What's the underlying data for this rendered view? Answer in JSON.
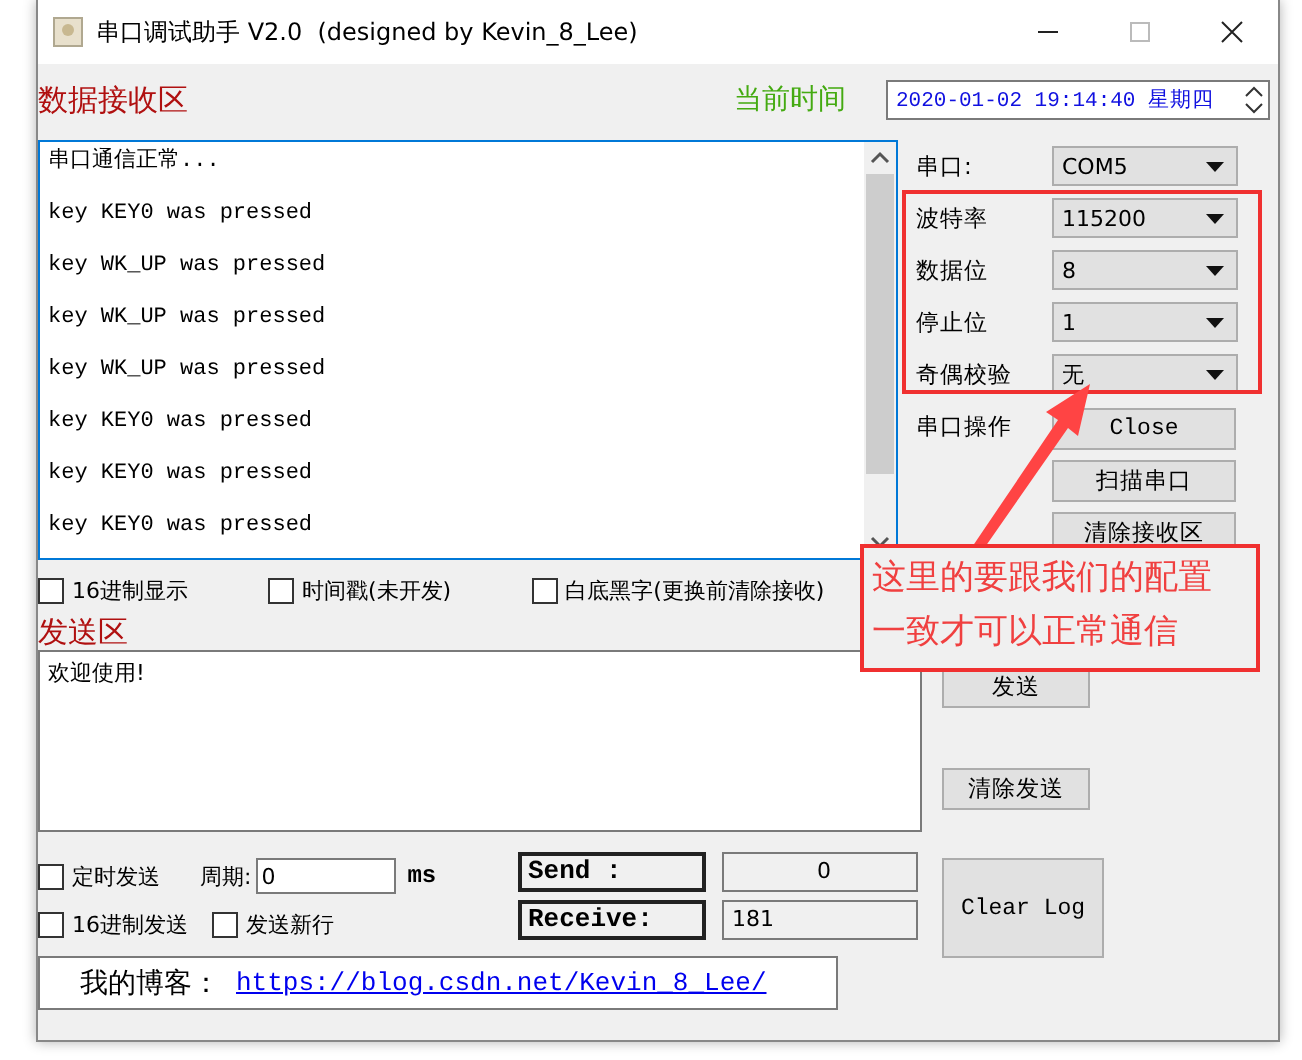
{
  "window": {
    "title": "串口调试助手 V2.0  (designed by Kevin_8_Lee)"
  },
  "receive": {
    "title": "数据接收区",
    "lines": [
      "串口通信正常...",
      "key KEY0 was pressed",
      "key WK_UP was pressed",
      "key WK_UP was pressed",
      "key WK_UP was pressed",
      "key KEY0 was pressed",
      "key KEY0 was pressed",
      "key KEY0 was pressed"
    ]
  },
  "clock": {
    "label": "当前时间",
    "value": "2020-01-02 19:14:40 星期四"
  },
  "receive_options": [
    {
      "label": "16进制显示",
      "checked": false
    },
    {
      "label": "时间戳(未开发)",
      "checked": false
    },
    {
      "label": "白底黑字(更换前清除接收)",
      "checked": false
    }
  ],
  "port_settings": [
    {
      "label": "串口:",
      "value": "COM5"
    },
    {
      "label": "波特率",
      "value": "115200"
    },
    {
      "label": "数据位",
      "value": "8"
    },
    {
      "label": "停止位",
      "value": "1"
    },
    {
      "label": "奇偶校验",
      "value": "无"
    }
  ],
  "port_action": {
    "label": "串口操作",
    "buttons": [
      "Close",
      "扫描串口",
      "清除接收区"
    ]
  },
  "send": {
    "title": "发送区",
    "text": "欢迎使用!",
    "buttons": [
      "发送",
      "清除发送"
    ]
  },
  "timed_send": {
    "label": "定时发送",
    "checked": false,
    "period_label": "周期:",
    "period": "0",
    "unit": "ms"
  },
  "send_options": [
    {
      "label": "16进制发送",
      "checked": false
    },
    {
      "label": "发送新行",
      "checked": false
    }
  ],
  "counters": [
    {
      "label": "Send :",
      "value": "0"
    },
    {
      "label": "Receive:",
      "value": "181"
    }
  ],
  "clear_log": "Clear Log",
  "blog": {
    "label": "我的博客：",
    "link": "https://blog.csdn.net/Kevin_8_Lee/"
  },
  "annotation": {
    "lines": [
      "这里的要跟我们的配置",
      "一致才可以正常通信"
    ]
  }
}
